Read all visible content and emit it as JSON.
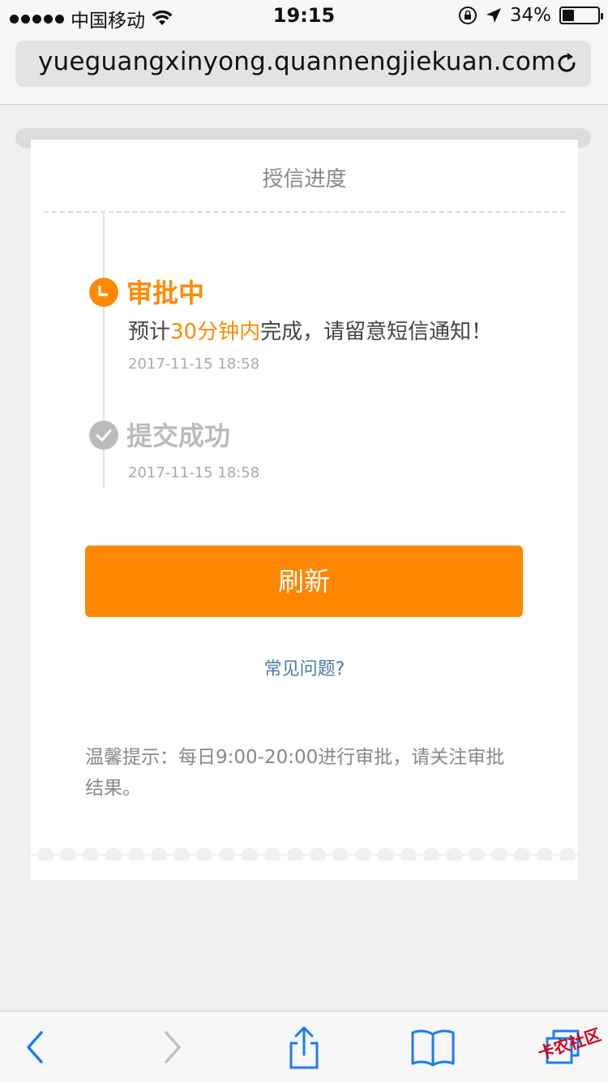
{
  "status_bar": {
    "carrier": "中国移动",
    "time": "19:15",
    "battery": "34%",
    "battery_level": 0.34
  },
  "browser": {
    "url": "yueguangxinyong.quannengjiekuan.com"
  },
  "card": {
    "title": "授信进度",
    "steps": [
      {
        "title": "审批中",
        "desc_prefix": "预计",
        "desc_highlight": "30分钟内",
        "desc_suffix": "完成，请留意短信通知！",
        "time": "2017-11-15 18:58",
        "status": "in-progress",
        "color": "#ff8a00"
      },
      {
        "title": "提交成功",
        "time": "2017-11-15 18:58",
        "status": "done",
        "color": "#bbbbbb"
      }
    ],
    "refresh_label": "刷新",
    "faq_label": "常见问题?",
    "tip": "温馨提示：每日9:00-20:00进行审批，请关注审批结果。"
  },
  "toolbar": {
    "icons": [
      "back-icon",
      "forward-icon",
      "share-icon",
      "bookmarks-icon",
      "tabs-icon"
    ]
  },
  "watermark": "卡农社区",
  "colors": {
    "accent": "#ff8600",
    "link": "#4a7ba7",
    "muted": "#888888"
  }
}
